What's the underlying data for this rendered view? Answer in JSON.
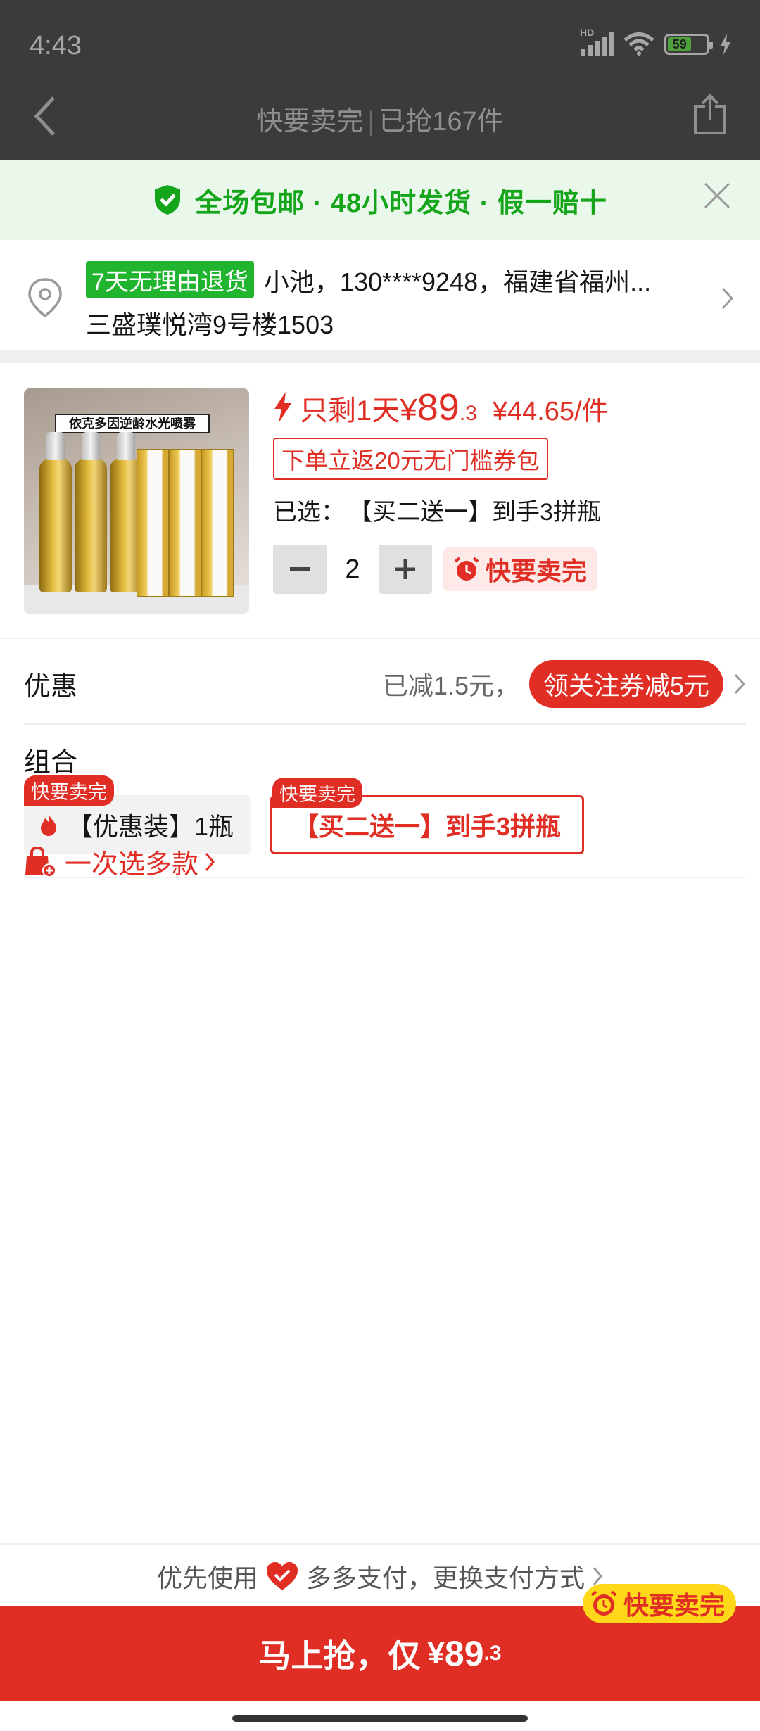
{
  "status": {
    "time": "4:43",
    "network": "HD",
    "battery": "59"
  },
  "nav": {
    "title_left": "快要卖完",
    "separator": "|",
    "title_right": "已抢167件"
  },
  "banner": {
    "text": "全场包邮 · 48小时发货 · 假一赔十"
  },
  "address": {
    "tag": "7天无理由退货",
    "line1": "小池，130****9248，福建省福州...",
    "line2": "三盛璞悦湾9号楼1503"
  },
  "product": {
    "image_label": "依克多因逆龄水光喷雾",
    "left_text": "只剩1天",
    "currency": "¥",
    "price_int": "89",
    "price_dec": ".3",
    "unit_price": "¥44.65/件",
    "coupon": "下单立返20元无门槛券包",
    "selected_key": "已选：",
    "selected_value": "【买二送一】到手3拼瓶",
    "quantity": "2",
    "hot_label": "快要卖完"
  },
  "discount": {
    "label": "优惠",
    "reduced": "已减1.5元，",
    "pill": "领关注券减5元"
  },
  "combo": {
    "label": "组合",
    "options": [
      {
        "badge": "快要卖完",
        "text": "【优惠装】1瓶"
      },
      {
        "badge": "快要卖完",
        "text": "【买二送一】到手3拼瓶"
      }
    ]
  },
  "multi": {
    "text": "一次选多款"
  },
  "pay": {
    "prefix": "优先使用",
    "text": "多多支付，更换支付方式"
  },
  "cta": {
    "text": "马上抢，仅",
    "currency": "¥",
    "price_int": "89",
    "price_dec": ".3",
    "badge": "快要卖完"
  },
  "colors": {
    "accent": "#e02e24",
    "green": "#14a51a",
    "badge_yellow": "#ffd81a"
  }
}
